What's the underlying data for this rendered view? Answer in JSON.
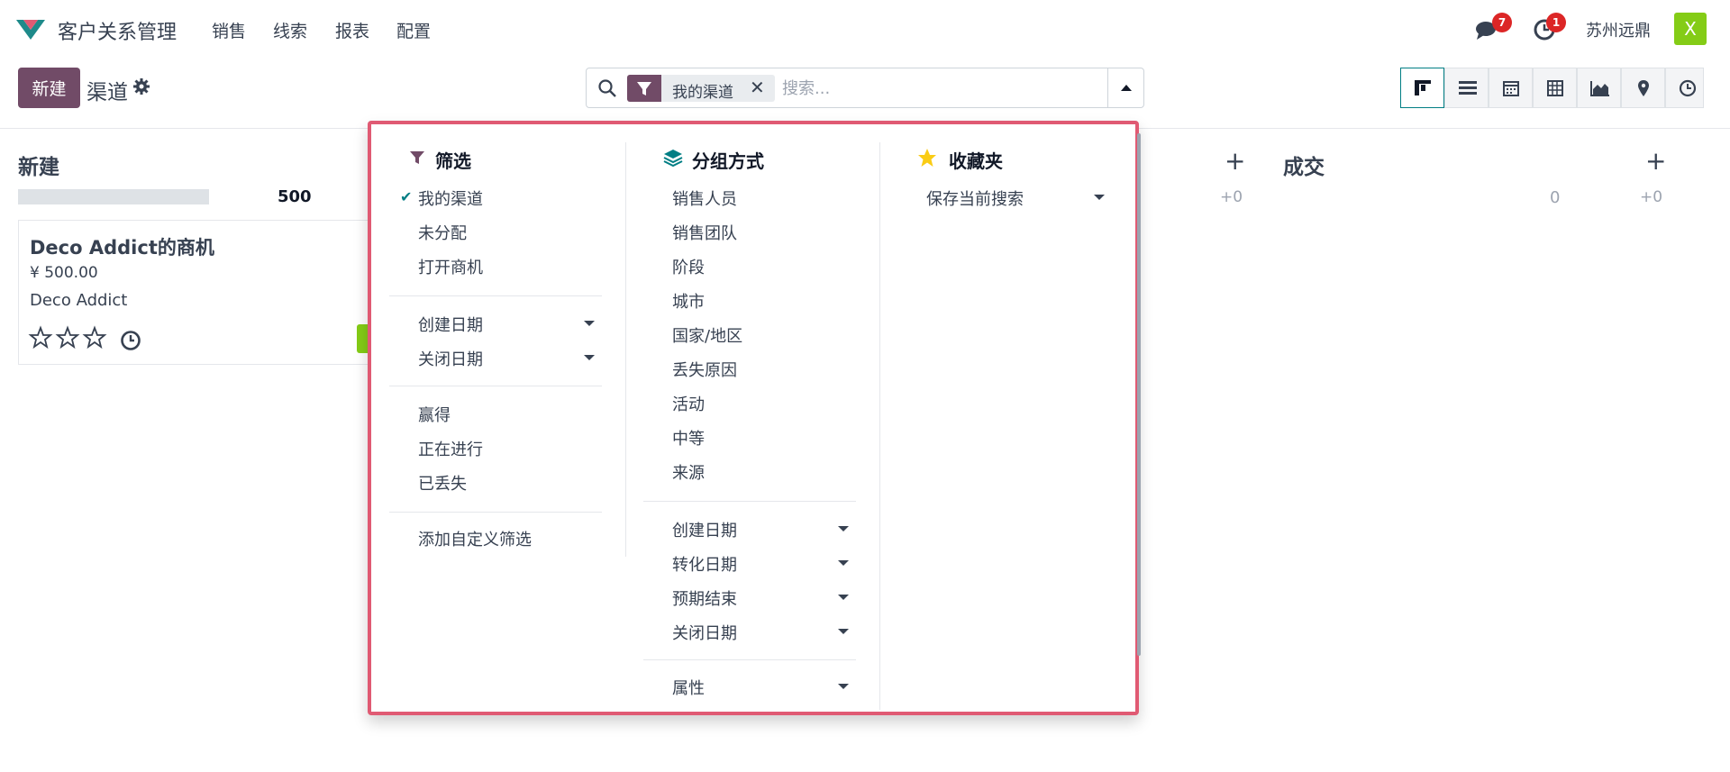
{
  "topnav": {
    "app_title": "客户关系管理",
    "menu": [
      "销售",
      "线索",
      "报表",
      "配置"
    ],
    "messages_count": "7",
    "activities_count": "1",
    "company": "苏州远鼎",
    "avatar_letter": "X"
  },
  "control": {
    "new_button": "新建",
    "breadcrumb": "渠道",
    "search": {
      "facet": "我的渠道",
      "facet_close": "✕",
      "placeholder": "搜索..."
    },
    "views": [
      "kanban-icon",
      "list-icon",
      "calendar-icon",
      "pivot-icon",
      "graph-icon",
      "map-icon",
      "activity-icon"
    ]
  },
  "kanban": {
    "columns": [
      {
        "title": "新建",
        "total": "500"
      },
      {
        "plus": "+",
        "sub": "+0"
      },
      {
        "title": "成交",
        "total": "0",
        "plus": "+",
        "sub": "+0"
      }
    ],
    "card": {
      "title": "Deco Addict的商机",
      "amount": "¥ 500.00",
      "partner": "Deco Addict"
    }
  },
  "dropdown": {
    "filters": {
      "title": "筛选",
      "group1": [
        "我的渠道",
        "未分配",
        "打开商机"
      ],
      "group2": [
        "创建日期",
        "关闭日期"
      ],
      "group3": [
        "赢得",
        "正在进行",
        "已丢失"
      ],
      "custom": "添加自定义筛选"
    },
    "groupby": {
      "title": "分组方式",
      "fields": [
        "销售人员",
        "销售团队",
        "阶段",
        "城市",
        "国家/地区",
        "丢失原因",
        "活动",
        "中等",
        "来源"
      ],
      "dates": [
        "创建日期",
        "转化日期",
        "预期结束",
        "关闭日期"
      ],
      "properties": "属性"
    },
    "favorites": {
      "title": "收藏夹",
      "save": "保存当前搜索"
    }
  },
  "colors": {
    "brand": "#714b67",
    "teal": "#017e84",
    "highlight_border": "#e05a73",
    "badge": "#dc2626",
    "avatar": "#84cc16"
  }
}
